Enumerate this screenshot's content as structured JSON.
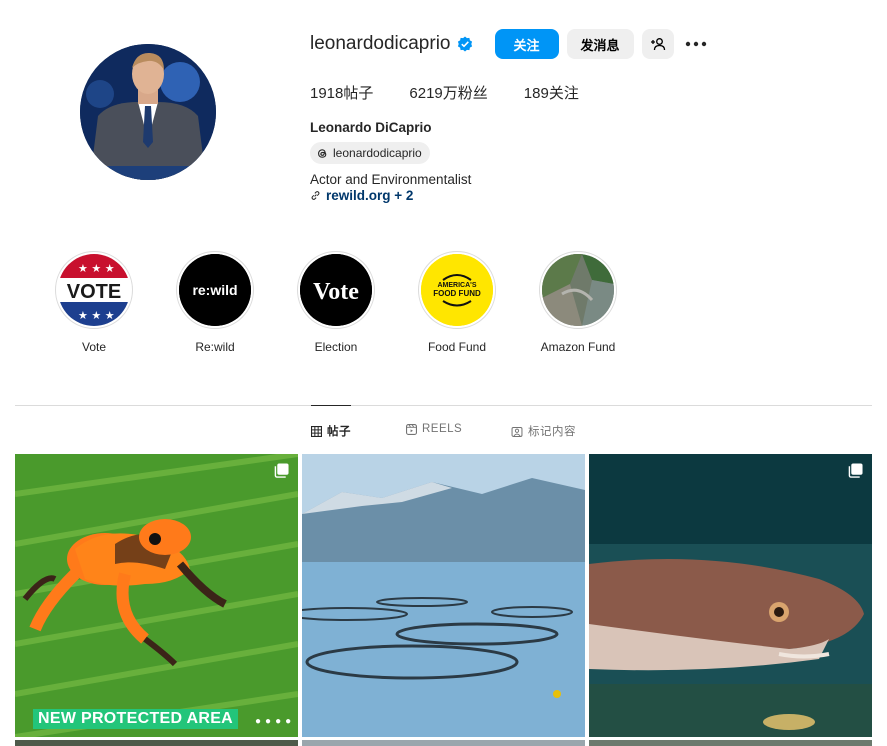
{
  "profile": {
    "username": "leonardodicaprio",
    "follow_label": "关注",
    "message_label": "发消息",
    "stats": {
      "posts": "1918",
      "posts_label": "帖子",
      "followers": "6219万",
      "followers_label": "粉丝",
      "following": "189",
      "following_label": "关注"
    },
    "full_name": "Leonardo DiCaprio",
    "threads_handle": "leonardodicaprio",
    "bio": "Actor and Environmentalist",
    "link": "rewild.org + 2"
  },
  "highlights": [
    {
      "label": "Vote",
      "icon": "vote-flag-icon"
    },
    {
      "label": "Re:wild",
      "icon": "rewild-logo"
    },
    {
      "label": "Election",
      "icon": "vote-text-logo"
    },
    {
      "label": "Food Fund",
      "icon": "americas-food-fund-logo"
    },
    {
      "label": "Amazon Fund",
      "icon": "aerial-forest-image"
    }
  ],
  "tabs": [
    {
      "label": "帖子",
      "icon": "grid-icon",
      "active": true
    },
    {
      "label": "REELS",
      "icon": "reels-icon",
      "active": false
    },
    {
      "label": "标记内容",
      "icon": "tagged-icon",
      "active": false
    }
  ],
  "posts": [
    {
      "caption": "NEW PROTECTED AREA",
      "image": "orange-frog",
      "multi": true
    },
    {
      "image": "fish-farm-fjord",
      "multi": false
    },
    {
      "image": "shark",
      "multi": true
    }
  ],
  "colors": {
    "accent": "#0095f6",
    "verified": "#0095f6",
    "caption_badge": "#23c57a",
    "link": "#00376b"
  }
}
